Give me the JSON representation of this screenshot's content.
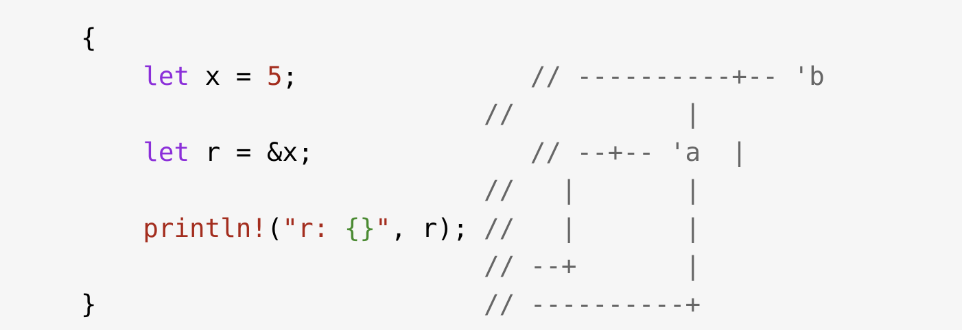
{
  "lines": [
    {
      "name": "line-1",
      "tokens": [
        {
          "type": "plain",
          "text": "{"
        }
      ]
    },
    {
      "name": "line-2",
      "tokens": [
        {
          "type": "plain",
          "text": "    "
        },
        {
          "type": "kw",
          "text": "let"
        },
        {
          "type": "plain",
          "text": " x = "
        },
        {
          "type": "num",
          "text": "5"
        },
        {
          "type": "plain",
          "text": ";               "
        },
        {
          "type": "cm",
          "text": "// ----------+-- 'b"
        }
      ]
    },
    {
      "name": "line-3",
      "tokens": [
        {
          "type": "plain",
          "text": "                          "
        },
        {
          "type": "cm",
          "text": "//           |"
        }
      ]
    },
    {
      "name": "line-4",
      "tokens": [
        {
          "type": "plain",
          "text": "    "
        },
        {
          "type": "kw",
          "text": "let"
        },
        {
          "type": "plain",
          "text": " r = &x;              "
        },
        {
          "type": "cm",
          "text": "// --+-- 'a  |"
        }
      ]
    },
    {
      "name": "line-5",
      "tokens": [
        {
          "type": "plain",
          "text": "                          "
        },
        {
          "type": "cm",
          "text": "//   |       |"
        }
      ]
    },
    {
      "name": "line-6",
      "tokens": [
        {
          "type": "plain",
          "text": "    "
        },
        {
          "type": "macro",
          "text": "println!"
        },
        {
          "type": "plain",
          "text": "("
        },
        {
          "type": "str",
          "text": "\"r: "
        },
        {
          "type": "str2",
          "text": "{}"
        },
        {
          "type": "str",
          "text": "\""
        },
        {
          "type": "plain",
          "text": ", r); "
        },
        {
          "type": "cm",
          "text": "//   |       |"
        }
      ]
    },
    {
      "name": "line-7",
      "tokens": [
        {
          "type": "plain",
          "text": "                          "
        },
        {
          "type": "cm",
          "text": "// --+       |"
        }
      ]
    },
    {
      "name": "line-8",
      "tokens": [
        {
          "type": "plain",
          "text": "}                         "
        },
        {
          "type": "cm",
          "text": "// ----------+"
        }
      ]
    }
  ],
  "colors": {
    "background": "#f6f6f6",
    "keyword": "#8b2fd9",
    "number": "#a32d1e",
    "macro": "#a32d1e",
    "string_quote": "#000000",
    "string_text": "#a32d1e",
    "string_placeholder": "#4a8a32",
    "comment": "#666666",
    "plain": "#000000"
  }
}
